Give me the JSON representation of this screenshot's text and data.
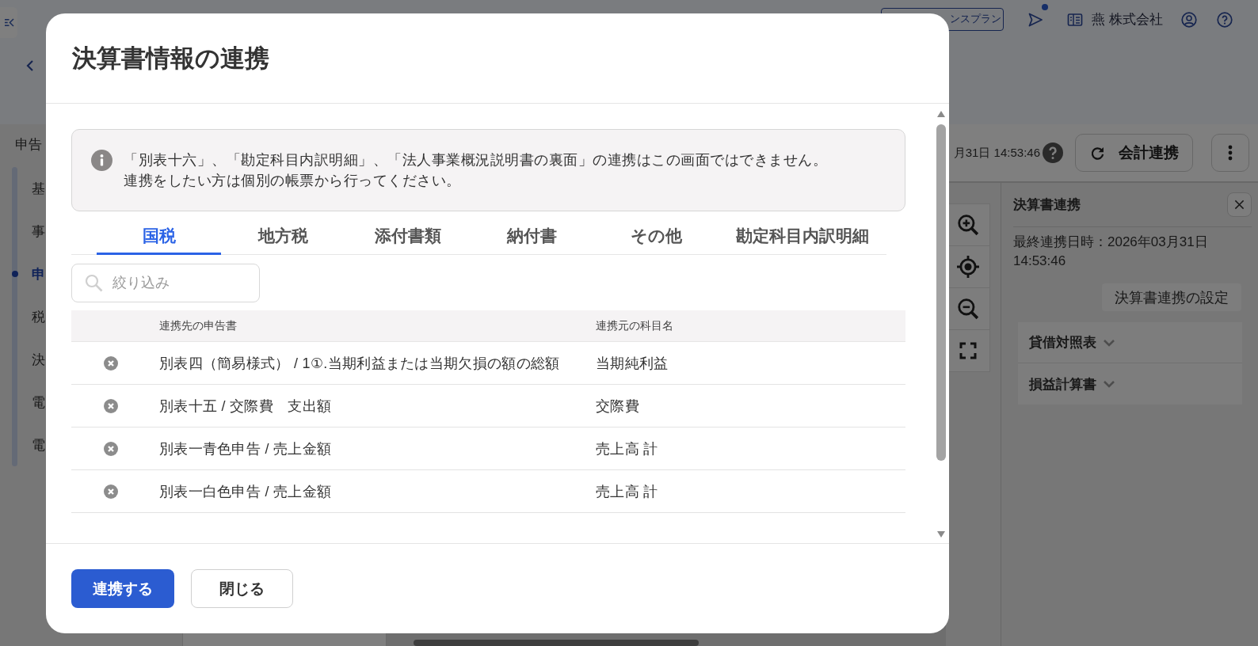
{
  "top_bar": {
    "plan_badge": "ンスプラン",
    "unread_notice": true,
    "company": "燕 株式会社"
  },
  "sidebar": {
    "heading": "申告",
    "items": [
      {
        "label": "基",
        "selected": false
      },
      {
        "label": "事",
        "selected": false
      },
      {
        "label": "申",
        "selected": true
      },
      {
        "label": "税",
        "selected": false
      },
      {
        "label": "決",
        "selected": false
      },
      {
        "label": "電",
        "selected": false
      },
      {
        "label": "電",
        "selected": false
      }
    ]
  },
  "toolbar": {
    "last_sync": "月31日 14:53:46",
    "sync_button": "会計連携"
  },
  "side_panel": {
    "title": "決算書連携",
    "last_sync": "最終連携日時：2026年03月31日 14:53:46",
    "settings_button": "決算書連携の設定",
    "sections": [
      {
        "label": "貸借対照表",
        "expanded": false
      },
      {
        "label": "損益計算書",
        "expanded": false
      }
    ]
  },
  "dialog": {
    "title": "決算書情報の連携",
    "notice": [
      "「別表十六」、「勘定科目内訳明細」、「法人事業概況説明書の裏面」の連携はこの画面ではできません。",
      "連携をしたい方は個別の帳票から行ってください。"
    ],
    "tabs": [
      {
        "label": "国税",
        "selected": true
      },
      {
        "label": "地方税",
        "selected": false
      },
      {
        "label": "添付書類",
        "selected": false
      },
      {
        "label": "納付書",
        "selected": false
      },
      {
        "label": "その他",
        "selected": false
      },
      {
        "label": "勘定科目内訳明細",
        "selected": false
      }
    ],
    "filter": {
      "placeholder": "絞り込み"
    },
    "table": {
      "columns": [
        "連携先の申告書",
        "連携元の科目名"
      ],
      "rows": [
        [
          "別表四（簡易様式） / 1①.当期利益または当期欠損の額の総額",
          "当期純利益"
        ],
        [
          "別表十五 / 交際費　支出額",
          "交際費"
        ],
        [
          "別表一青色申告 / 売上金額",
          "売上高 計"
        ],
        [
          "別表一白色申告 / 売上金額",
          "売上高 計"
        ]
      ]
    },
    "buttons": [
      {
        "label": "連携する",
        "kind": "primary"
      },
      {
        "label": "閉じる",
        "kind": "secondary"
      }
    ]
  }
}
